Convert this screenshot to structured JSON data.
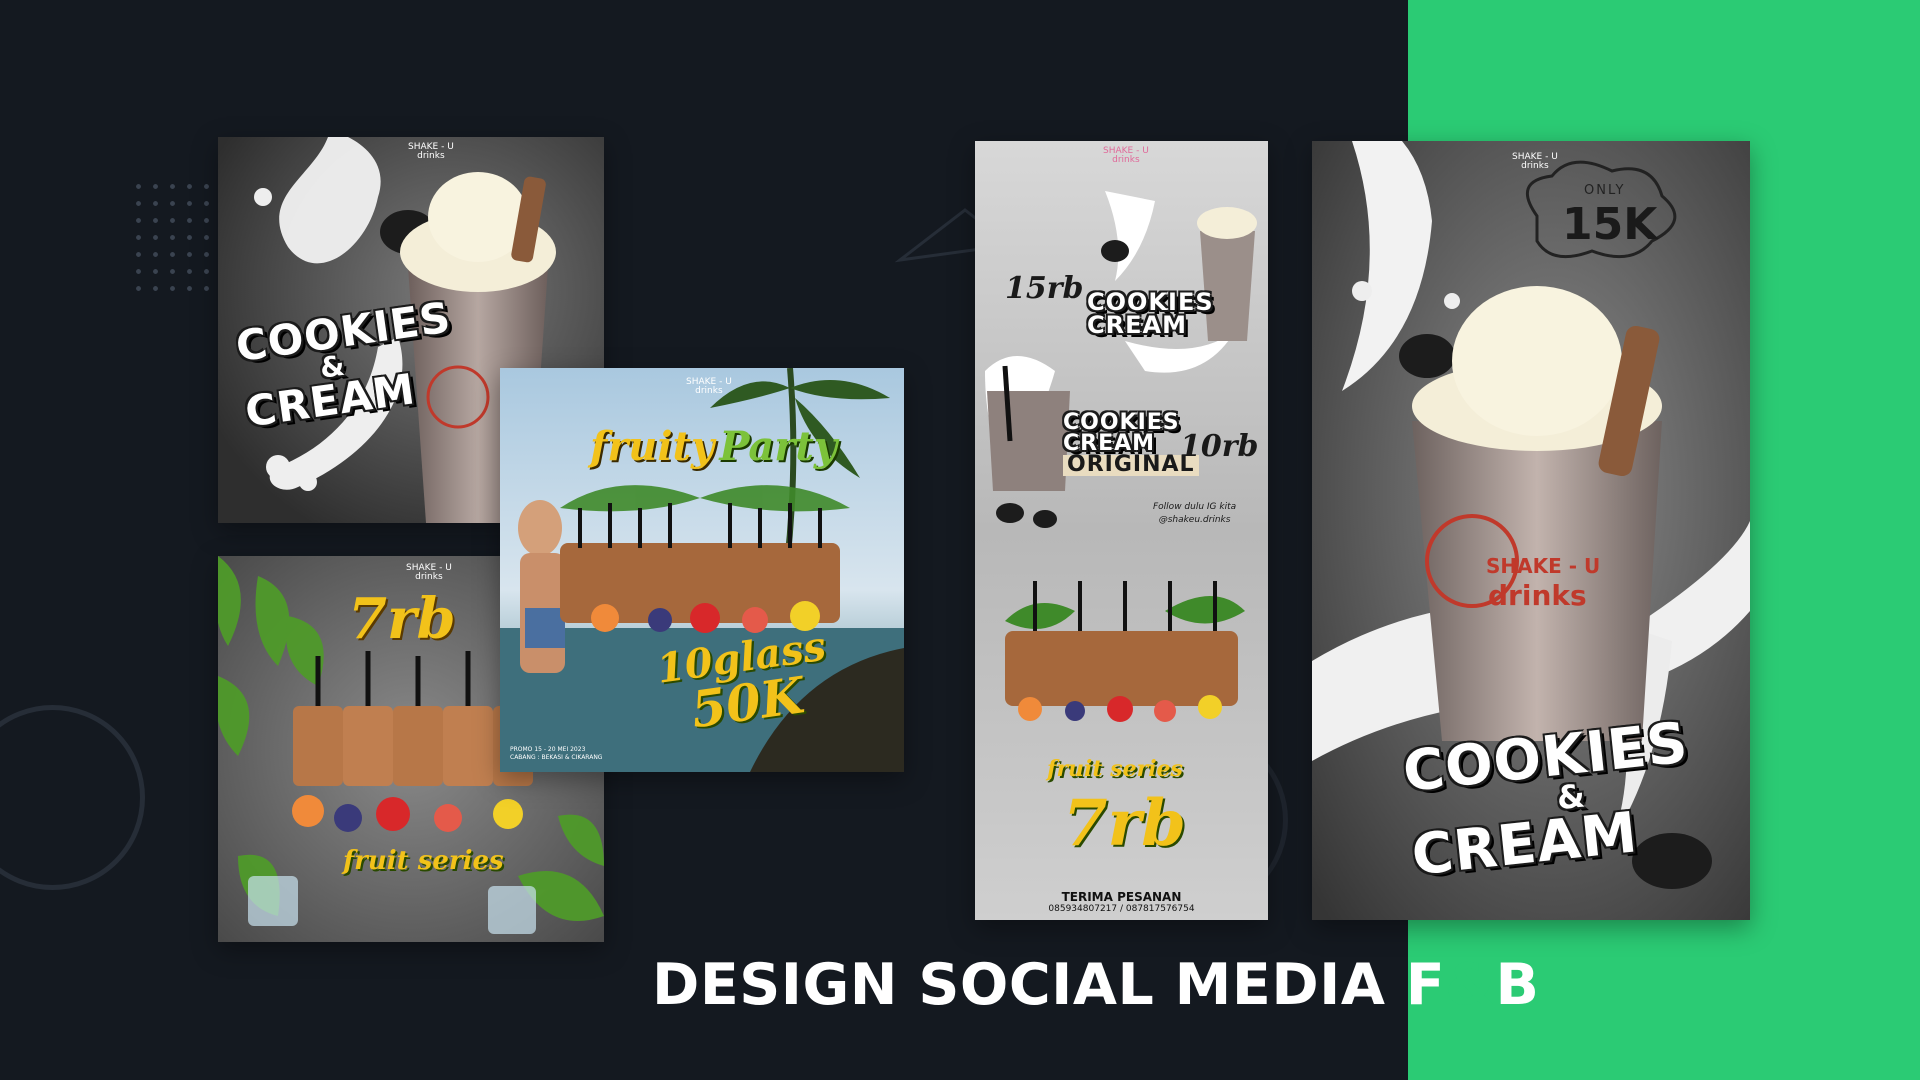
{
  "headline": {
    "main": "DESIGN SOCIAL MEDIA F",
    "amp": "&",
    "tail": "B"
  },
  "brand": {
    "line1": "SHAKE - U",
    "line2": "drinks"
  },
  "card_cookies_square": {
    "title_line1": "COOKIES",
    "title_amp": "&",
    "title_line2": "CREAM"
  },
  "card_fruity_party": {
    "title_part1": "fruity",
    "title_part2": "Party",
    "promo_line1": "10glass",
    "promo_line2": "50K",
    "promo_dates": "PROMO 15 - 20 MEI 2023",
    "branch": "CABANG : BEKASI & CIKARANG"
  },
  "card_fruit_series_square": {
    "price": "7rb",
    "series": "fruit series"
  },
  "card_menu_story": {
    "price_top": "15rb",
    "title_top_line1": "COOKIES",
    "title_top_line2": "CREAM",
    "title_mid_line1": "COOKIES",
    "title_mid_line2": "CREAM",
    "title_mid_line3": "ORIGINAL",
    "price_mid": "10rb",
    "follow_line1": "Follow dulu IG kita",
    "follow_line2": "@shakeu.drinks",
    "series": "fruit series",
    "price_bottom": "7rb",
    "order_label": "TERIMA PESANAN",
    "phones": "085934807217 / 087817576754"
  },
  "card_cookies_story": {
    "badge_small": "ONLY",
    "badge_price": "15K",
    "title_line1": "COOKIES",
    "title_amp": "&",
    "title_line2": "CREAM",
    "cup_brand1": "SHAKE - U",
    "cup_brand2": "drinks"
  },
  "colors": {
    "background": "#141920",
    "green": "#2bcb74",
    "gray_card": "#5a5a5a",
    "accent_yellow": "#f2c21a",
    "accent_green": "#6fbf2c"
  }
}
